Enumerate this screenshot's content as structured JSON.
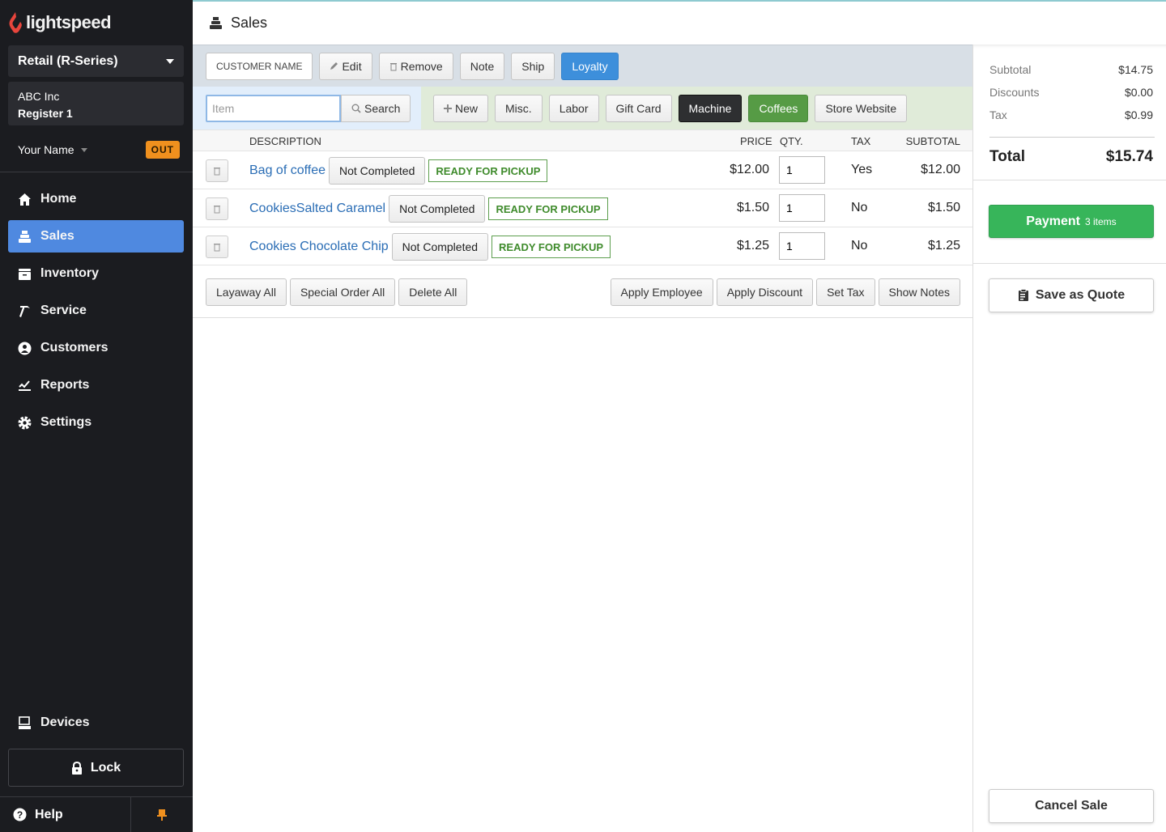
{
  "brand": {
    "name": "lightspeed",
    "accent": "#e8453c"
  },
  "sidebar": {
    "product_select": "Retail (R-Series)",
    "company": "ABC Inc",
    "register": "Register 1",
    "user_name": "Your Name",
    "clock_badge": "OUT",
    "nav": [
      {
        "label": "Home",
        "icon": "home-icon",
        "active": false
      },
      {
        "label": "Sales",
        "icon": "register-icon",
        "active": true
      },
      {
        "label": "Inventory",
        "icon": "archive-icon",
        "active": false
      },
      {
        "label": "Service",
        "icon": "hammer-icon",
        "active": false
      },
      {
        "label": "Customers",
        "icon": "user-circle-icon",
        "active": false
      },
      {
        "label": "Reports",
        "icon": "chart-line-icon",
        "active": false
      },
      {
        "label": "Settings",
        "icon": "gear-icon",
        "active": false
      }
    ],
    "devices": "Devices",
    "lock": "Lock",
    "help": "Help"
  },
  "header": {
    "title": "Sales"
  },
  "customer_bar": {
    "customer_name": "CUSTOMER NAME",
    "edit": "Edit",
    "remove": "Remove",
    "note": "Note",
    "ship": "Ship",
    "loyalty": "Loyalty"
  },
  "item_bar": {
    "item_placeholder": "Item",
    "item_value": "",
    "search": "Search",
    "quick_buttons": [
      "New",
      "Misc.",
      "Labor",
      "Gift Card",
      "Machine",
      "Coffees",
      "Store Website"
    ]
  },
  "table": {
    "headers": {
      "description": "DESCRIPTION",
      "price": "PRICE",
      "qty": "QTY.",
      "tax": "TAX",
      "subtotal": "SUBTOTAL"
    },
    "rows": [
      {
        "description": "Bag of coffee",
        "status": "Not Completed",
        "pickup": "READY FOR PICKUP",
        "price": "$12.00",
        "qty": "1",
        "tax": "Yes",
        "subtotal": "$12.00"
      },
      {
        "description": "CookiesSalted Caramel",
        "status": "Not Completed",
        "pickup": "READY FOR PICKUP",
        "price": "$1.50",
        "qty": "1",
        "tax": "No",
        "subtotal": "$1.50"
      },
      {
        "description": "Cookies Chocolate Chip",
        "status": "Not Completed",
        "pickup": "READY FOR PICKUP",
        "price": "$1.25",
        "qty": "1",
        "tax": "No",
        "subtotal": "$1.25"
      }
    ]
  },
  "actions": {
    "layaway_all": "Layaway All",
    "special_order_all": "Special Order All",
    "delete_all": "Delete All",
    "apply_employee": "Apply Employee",
    "apply_discount": "Apply Discount",
    "set_tax": "Set Tax",
    "show_notes": "Show Notes"
  },
  "summary": {
    "subtotal_label": "Subtotal",
    "subtotal": "$14.75",
    "discounts_label": "Discounts",
    "discounts": "$0.00",
    "tax_label": "Tax",
    "tax": "$0.99",
    "total_label": "Total",
    "total": "$15.74",
    "payment_label": "Payment",
    "payment_count": "3 items",
    "save_quote": "Save as Quote",
    "cancel_sale": "Cancel Sale"
  }
}
